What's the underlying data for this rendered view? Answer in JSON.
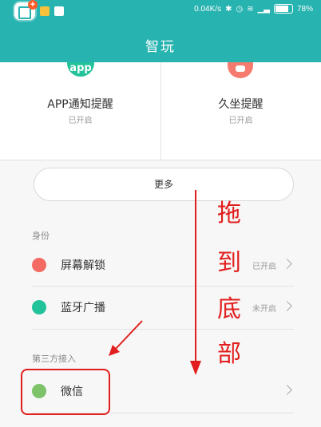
{
  "status_bar": {
    "speed": "0.04K/s",
    "battery": "78%"
  },
  "header": {
    "title": "智玩"
  },
  "features": [
    {
      "badge": "app",
      "label": "APP通知提醒",
      "status": "已开启"
    },
    {
      "badge": "",
      "label": "久坐提醒",
      "status": "已开启"
    }
  ],
  "more_button": "更多",
  "sections": {
    "identity": {
      "label": "身份",
      "items": [
        {
          "label": "屏幕解锁",
          "status": "已开启",
          "color": "#f36b63"
        },
        {
          "label": "蓝牙广播",
          "status": "未开启",
          "color": "#22c29a"
        }
      ]
    },
    "third_party": {
      "label": "第三方接入",
      "items": [
        {
          "label": "微信",
          "status": "",
          "color": "#7cc36a"
        }
      ]
    }
  },
  "annotation": {
    "chars": [
      "拖",
      "到",
      "底",
      "部"
    ],
    "color": "#e21d1d"
  },
  "colors": {
    "header_bg": "#27b3b0"
  }
}
